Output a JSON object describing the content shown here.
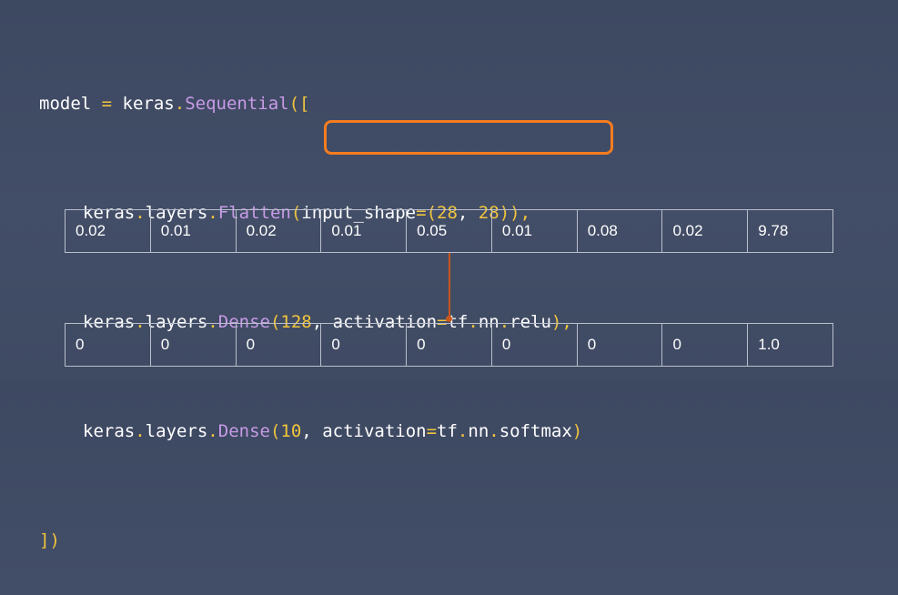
{
  "code": {
    "line1": [
      {
        "text": "model ",
        "kind": "plain"
      },
      {
        "text": "= ",
        "kind": "op"
      },
      {
        "text": "keras",
        "kind": "plain"
      },
      {
        "text": ".",
        "kind": "op"
      },
      {
        "text": "Sequential",
        "kind": "fn"
      },
      {
        "text": "([",
        "kind": "op"
      }
    ],
    "line2": [
      {
        "text": "keras",
        "kind": "plain"
      },
      {
        "text": ".",
        "kind": "op"
      },
      {
        "text": "layers",
        "kind": "plain"
      },
      {
        "text": ".",
        "kind": "op"
      },
      {
        "text": "Flatten",
        "kind": "fn"
      },
      {
        "text": "(",
        "kind": "op"
      },
      {
        "text": "input_shape",
        "kind": "plain"
      },
      {
        "text": "=(",
        "kind": "op"
      },
      {
        "text": "28",
        "kind": "num"
      },
      {
        "text": ", ",
        "kind": "plain"
      },
      {
        "text": "28",
        "kind": "num"
      },
      {
        "text": ")),",
        "kind": "op"
      }
    ],
    "line3": [
      {
        "text": "keras",
        "kind": "plain"
      },
      {
        "text": ".",
        "kind": "op"
      },
      {
        "text": "layers",
        "kind": "plain"
      },
      {
        "text": ".",
        "kind": "op"
      },
      {
        "text": "Dense",
        "kind": "fn"
      },
      {
        "text": "(",
        "kind": "op"
      },
      {
        "text": "128",
        "kind": "num"
      },
      {
        "text": ", ",
        "kind": "plain"
      },
      {
        "text": "activation",
        "kind": "plain"
      },
      {
        "text": "=",
        "kind": "op"
      },
      {
        "text": "tf",
        "kind": "plain"
      },
      {
        "text": ".",
        "kind": "op"
      },
      {
        "text": "nn",
        "kind": "plain"
      },
      {
        "text": ".",
        "kind": "op"
      },
      {
        "text": "relu",
        "kind": "plain"
      },
      {
        "text": "),",
        "kind": "op"
      }
    ],
    "line4": [
      {
        "text": "keras",
        "kind": "plain"
      },
      {
        "text": ".",
        "kind": "op"
      },
      {
        "text": "layers",
        "kind": "plain"
      },
      {
        "text": ".",
        "kind": "op"
      },
      {
        "text": "Dense",
        "kind": "fn"
      },
      {
        "text": "(",
        "kind": "op"
      },
      {
        "text": "10",
        "kind": "num"
      },
      {
        "text": ", ",
        "kind": "plain"
      },
      {
        "text": "activation",
        "kind": "plain"
      },
      {
        "text": "=",
        "kind": "op"
      },
      {
        "text": "tf",
        "kind": "plain"
      },
      {
        "text": ".",
        "kind": "op"
      },
      {
        "text": "nn",
        "kind": "plain"
      },
      {
        "text": ".",
        "kind": "op"
      },
      {
        "text": "softmax",
        "kind": "plain"
      },
      {
        "text": ")",
        "kind": "op"
      }
    ],
    "line5": [
      {
        "text": "])",
        "kind": "op"
      }
    ]
  },
  "top_row": [
    "0.02",
    "0.01",
    "0.02",
    "0.01",
    "0.05",
    "0.01",
    "0.08",
    "0.02",
    "9.78"
  ],
  "bottom_row": [
    "0",
    "0",
    "0",
    "0",
    "0",
    "0",
    "0",
    "0",
    "1.0"
  ],
  "colors": {
    "background": "#414c66",
    "highlight": "#f57c1f",
    "connector": "#c8571e",
    "keyword_function": "#c79be6",
    "operator": "#f2c53d"
  }
}
